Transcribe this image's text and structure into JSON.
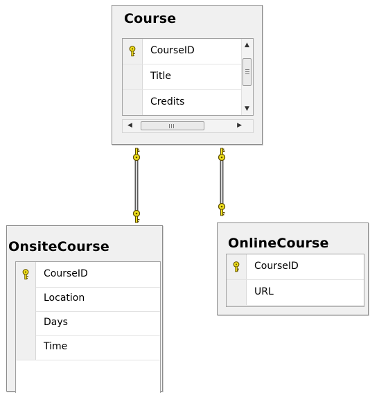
{
  "tables": {
    "course": {
      "name": "Course",
      "columns": [
        {
          "name": "CourseID",
          "primary_key": true
        },
        {
          "name": "Title",
          "primary_key": false
        },
        {
          "name": "Credits",
          "primary_key": false
        }
      ],
      "scroll_glyph": "III"
    },
    "onsite_course": {
      "name": "OnsiteCourse",
      "columns": [
        {
          "name": "CourseID",
          "primary_key": true
        },
        {
          "name": "Location",
          "primary_key": false
        },
        {
          "name": "Days",
          "primary_key": false
        },
        {
          "name": "Time",
          "primary_key": false
        }
      ]
    },
    "online_course": {
      "name": "OnlineCourse",
      "columns": [
        {
          "name": "CourseID",
          "primary_key": true
        },
        {
          "name": "URL",
          "primary_key": false
        }
      ]
    }
  },
  "relationships": [
    {
      "from": "Course",
      "to": "OnsiteCourse",
      "type": "one-to-one"
    },
    {
      "from": "Course",
      "to": "OnlineCourse",
      "type": "one-to-one"
    }
  ],
  "colors": {
    "key_fill": "#f2e21c",
    "key_outline": "#6b5a00",
    "window_bg": "#f0f0f0",
    "border": "#8c8c8c"
  },
  "icons": {
    "primary_key": "key-icon",
    "relationship_end": "key-connector-icon"
  }
}
